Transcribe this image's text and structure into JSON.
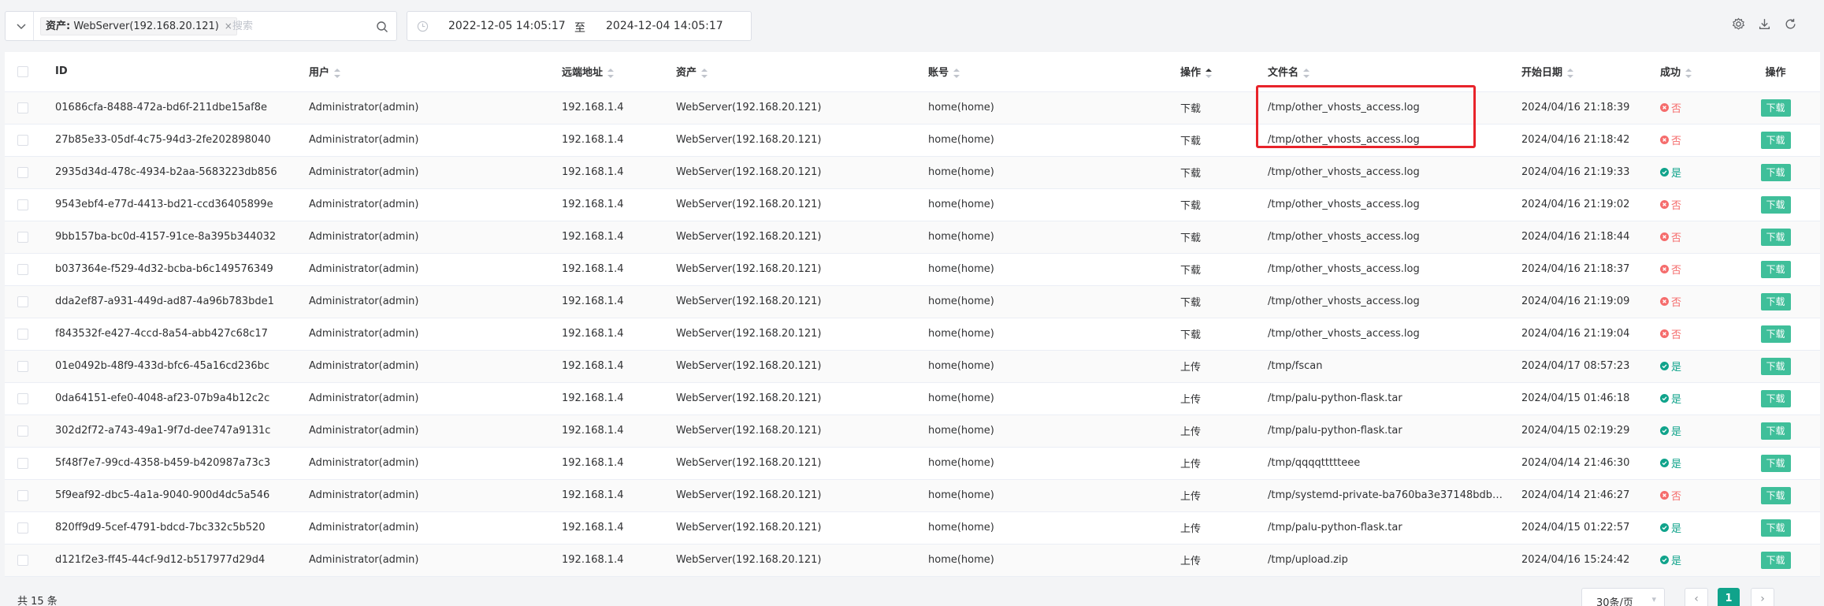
{
  "filter": {
    "tag_label": "资产:",
    "tag_value": "WebServer(192.168.20.121)",
    "tag_close": "×",
    "search_placeholder": "搜索"
  },
  "date_range": {
    "start": "2022-12-05 14:05:17",
    "separator": "至",
    "end": "2024-12-04 14:05:17"
  },
  "table": {
    "headers": {
      "id": "ID",
      "user": "用户",
      "remote": "远端地址",
      "asset": "资产",
      "account": "账号",
      "operate": "操作",
      "filename": "文件名",
      "start_date": "开始日期",
      "success": "成功",
      "actions": "操作"
    },
    "download_label": "下载",
    "rows": [
      {
        "id": "01686cfa-8488-472a-bd6f-211dbe15af8e",
        "user": "Administrator(admin)",
        "remote": "192.168.1.4",
        "asset": "WebServer(192.168.20.121)",
        "account": "home(home)",
        "operate": "下载",
        "filename": "/tmp/other_vhosts_access.log",
        "date": "2024/04/16 21:18:39",
        "success": "否",
        "ok": false
      },
      {
        "id": "27b85e33-05df-4c75-94d3-2fe202898040",
        "user": "Administrator(admin)",
        "remote": "192.168.1.4",
        "asset": "WebServer(192.168.20.121)",
        "account": "home(home)",
        "operate": "下载",
        "filename": "/tmp/other_vhosts_access.log",
        "date": "2024/04/16 21:18:42",
        "success": "否",
        "ok": false
      },
      {
        "id": "2935d34d-478c-4934-b2aa-5683223db856",
        "user": "Administrator(admin)",
        "remote": "192.168.1.4",
        "asset": "WebServer(192.168.20.121)",
        "account": "home(home)",
        "operate": "下载",
        "filename": "/tmp/other_vhosts_access.log",
        "date": "2024/04/16 21:19:33",
        "success": "是",
        "ok": true
      },
      {
        "id": "9543ebf4-e77d-4413-bd21-ccd36405899e",
        "user": "Administrator(admin)",
        "remote": "192.168.1.4",
        "asset": "WebServer(192.168.20.121)",
        "account": "home(home)",
        "operate": "下载",
        "filename": "/tmp/other_vhosts_access.log",
        "date": "2024/04/16 21:19:02",
        "success": "否",
        "ok": false
      },
      {
        "id": "9bb157ba-bc0d-4157-91ce-8a395b344032",
        "user": "Administrator(admin)",
        "remote": "192.168.1.4",
        "asset": "WebServer(192.168.20.121)",
        "account": "home(home)",
        "operate": "下载",
        "filename": "/tmp/other_vhosts_access.log",
        "date": "2024/04/16 21:18:44",
        "success": "否",
        "ok": false
      },
      {
        "id": "b037364e-f529-4d32-bcba-b6c149576349",
        "user": "Administrator(admin)",
        "remote": "192.168.1.4",
        "asset": "WebServer(192.168.20.121)",
        "account": "home(home)",
        "operate": "下载",
        "filename": "/tmp/other_vhosts_access.log",
        "date": "2024/04/16 21:18:37",
        "success": "否",
        "ok": false
      },
      {
        "id": "dda2ef87-a931-449d-ad87-4a96b783bde1",
        "user": "Administrator(admin)",
        "remote": "192.168.1.4",
        "asset": "WebServer(192.168.20.121)",
        "account": "home(home)",
        "operate": "下载",
        "filename": "/tmp/other_vhosts_access.log",
        "date": "2024/04/16 21:19:09",
        "success": "否",
        "ok": false
      },
      {
        "id": "f843532f-e427-4ccd-8a54-abb427c68c17",
        "user": "Administrator(admin)",
        "remote": "192.168.1.4",
        "asset": "WebServer(192.168.20.121)",
        "account": "home(home)",
        "operate": "下载",
        "filename": "/tmp/other_vhosts_access.log",
        "date": "2024/04/16 21:19:04",
        "success": "否",
        "ok": false
      },
      {
        "id": "01e0492b-48f9-433d-bfc6-45a16cd236bc",
        "user": "Administrator(admin)",
        "remote": "192.168.1.4",
        "asset": "WebServer(192.168.20.121)",
        "account": "home(home)",
        "operate": "上传",
        "filename": "/tmp/fscan",
        "date": "2024/04/17 08:57:23",
        "success": "是",
        "ok": true
      },
      {
        "id": "0da64151-efe0-4048-af23-07b9a4b12c2c",
        "user": "Administrator(admin)",
        "remote": "192.168.1.4",
        "asset": "WebServer(192.168.20.121)",
        "account": "home(home)",
        "operate": "上传",
        "filename": "/tmp/palu-python-flask.tar",
        "date": "2024/04/15 01:46:18",
        "success": "是",
        "ok": true
      },
      {
        "id": "302d2f72-a743-49a1-9f7d-dee747a9131c",
        "user": "Administrator(admin)",
        "remote": "192.168.1.4",
        "asset": "WebServer(192.168.20.121)",
        "account": "home(home)",
        "operate": "上传",
        "filename": "/tmp/palu-python-flask.tar",
        "date": "2024/04/15 02:19:29",
        "success": "是",
        "ok": true
      },
      {
        "id": "5f48f7e7-99cd-4358-b459-b420987a73c3",
        "user": "Administrator(admin)",
        "remote": "192.168.1.4",
        "asset": "WebServer(192.168.20.121)",
        "account": "home(home)",
        "operate": "上传",
        "filename": "/tmp/qqqqttttteee",
        "date": "2024/04/14 21:46:30",
        "success": "是",
        "ok": true
      },
      {
        "id": "5f9eaf92-dbc5-4a1a-9040-900d4dc5a546",
        "user": "Administrator(admin)",
        "remote": "192.168.1.4",
        "asset": "WebServer(192.168.20.121)",
        "account": "home(home)",
        "operate": "上传",
        "filename": "/tmp/systemd-private-ba760ba3e37148bdb…",
        "date": "2024/04/14 21:46:27",
        "success": "否",
        "ok": false
      },
      {
        "id": "820ff9d9-5cef-4791-bdcd-7bc332c5b520",
        "user": "Administrator(admin)",
        "remote": "192.168.1.4",
        "asset": "WebServer(192.168.20.121)",
        "account": "home(home)",
        "operate": "上传",
        "filename": "/tmp/palu-python-flask.tar",
        "date": "2024/04/15 01:22:57",
        "success": "是",
        "ok": true
      },
      {
        "id": "d121f2e3-ff45-44cf-9d12-b517977d29d4",
        "user": "Administrator(admin)",
        "remote": "192.168.1.4",
        "asset": "WebServer(192.168.20.121)",
        "account": "home(home)",
        "operate": "上传",
        "filename": "/tmp/upload.zip",
        "date": "2024/04/16 15:24:42",
        "success": "是",
        "ok": true
      }
    ]
  },
  "footer": {
    "total": "共 15 条",
    "page_size": "30条/页",
    "current_page": "1",
    "prev": "‹",
    "next": "›"
  },
  "colors": {
    "accent": "#10a38b",
    "download_button": "#3fbf9a",
    "fail": "#f56c6c",
    "highlight": "#e8232a"
  },
  "icons": [
    "chevron-down-icon",
    "search-icon",
    "clock-icon",
    "settings-icon",
    "download-icon",
    "refresh-icon",
    "sort-icon",
    "check-circle-icon",
    "x-circle-icon",
    "chevron-left-icon",
    "chevron-right-icon"
  ]
}
